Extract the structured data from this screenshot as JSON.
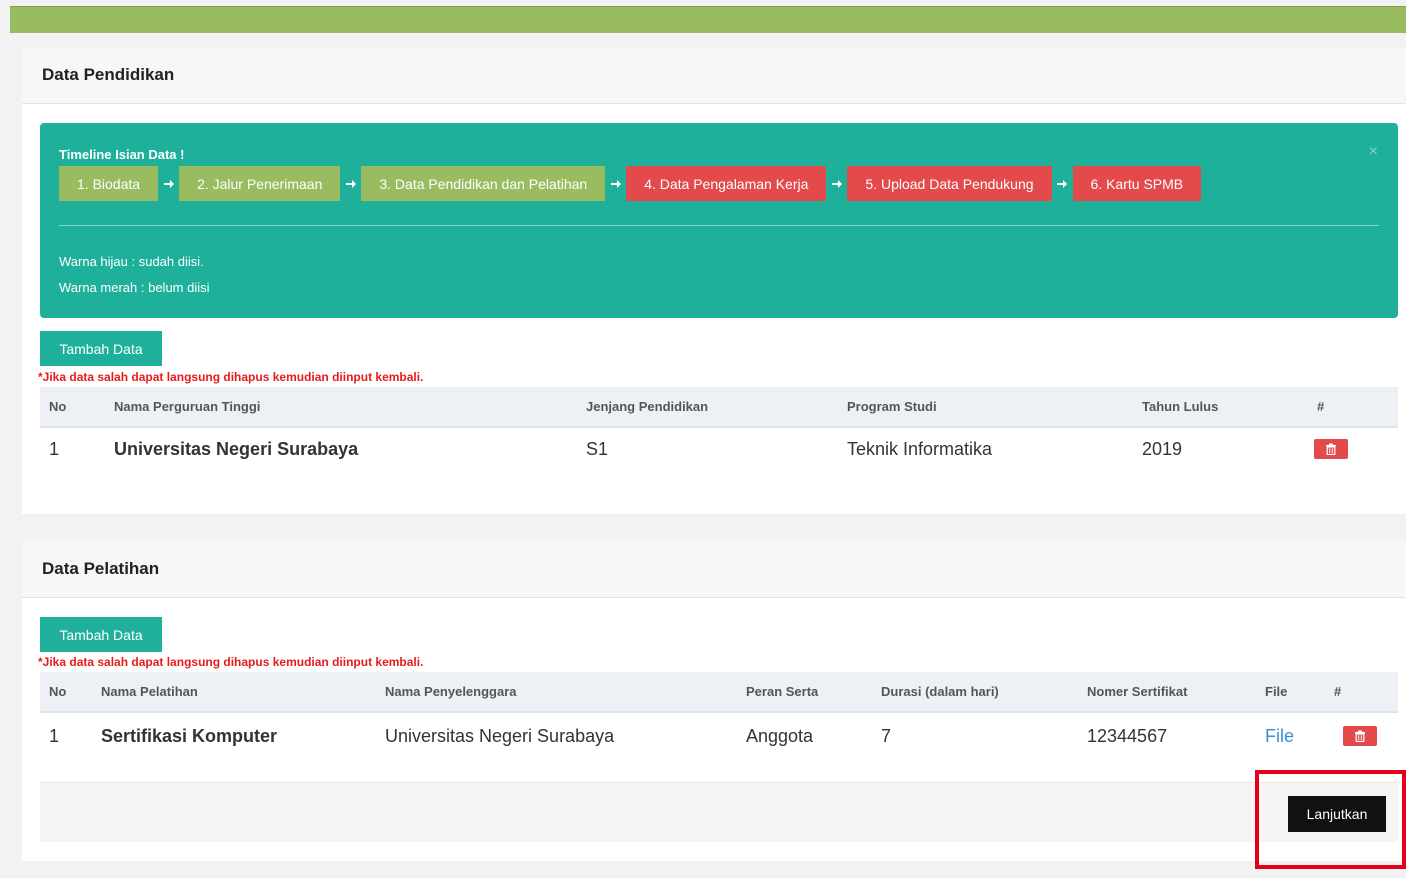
{
  "pendidikan": {
    "title": "Data Pendidikan",
    "timeline": {
      "title": "Timeline Isian Data !",
      "close": "×",
      "steps": [
        {
          "label": "1. Biodata",
          "status": "green"
        },
        {
          "label": "2. Jalur Penerimaan",
          "status": "green"
        },
        {
          "label": "3. Data Pendidikan dan Pelatihan",
          "status": "green"
        },
        {
          "label": "4. Data Pengalaman Kerja",
          "status": "red"
        },
        {
          "label": "5. Upload Data Pendukung",
          "status": "red"
        },
        {
          "label": "6. Kartu SPMB",
          "status": "red"
        }
      ],
      "legend_green": "Warna hijau : sudah diisi.",
      "legend_red": "Warna merah : belum diisi"
    },
    "add_label": "Tambah Data",
    "warning": "*Jika data salah dapat langsung dihapus kemudian diinput kembali.",
    "columns": [
      "No",
      "Nama Perguruan Tinggi",
      "Jenjang Pendidikan",
      "Program Studi",
      "Tahun Lulus",
      "#"
    ],
    "rows": [
      {
        "no": "1",
        "nama": "Universitas Negeri Surabaya",
        "jenjang": "S1",
        "prodi": "Teknik Informatika",
        "tahun": "2019"
      }
    ]
  },
  "pelatihan": {
    "title": "Data Pelatihan",
    "add_label": "Tambah Data",
    "warning": "*Jika data salah dapat langsung dihapus kemudian diinput kembali.",
    "columns": [
      "No",
      "Nama Pelatihan",
      "Nama Penyelenggara",
      "Peran Serta",
      "Durasi (dalam hari)",
      "Nomer Sertifikat",
      "File",
      "#"
    ],
    "rows": [
      {
        "no": "1",
        "nama": "Sertifikasi Komputer",
        "penyelenggara": "Universitas Negeri Surabaya",
        "peran": "Anggota",
        "durasi": "7",
        "sertifikat": "12344567",
        "file": "File"
      }
    ],
    "next_label": "Lanjutkan"
  },
  "colors": {
    "green": "#98bc5f",
    "red": "#e34a4c",
    "teal": "#1fb09b",
    "highlight": "#e4001b"
  },
  "icons": {
    "step_arrow": "arrow-right-icon",
    "delete": "trash-icon"
  }
}
